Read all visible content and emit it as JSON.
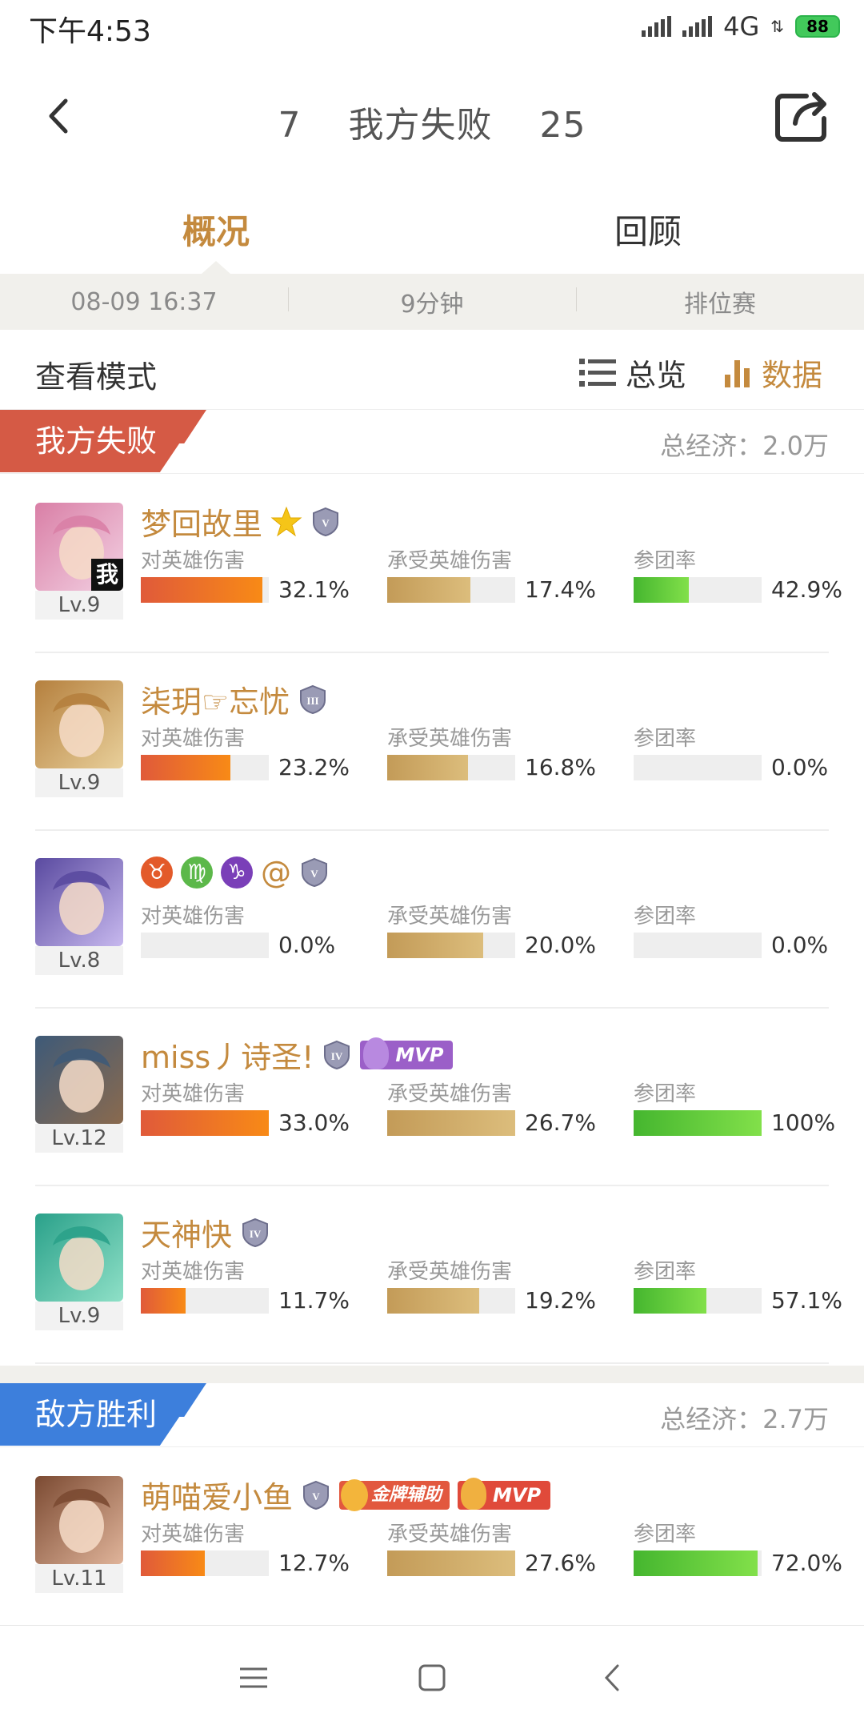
{
  "status": {
    "time": "下午4:53",
    "network": "4G",
    "battery": "88"
  },
  "header": {
    "kills_left": "7",
    "result": "我方失败",
    "kills_right": "25"
  },
  "tabs": [
    {
      "label": "概况"
    },
    {
      "label": "回顾"
    }
  ],
  "info": {
    "datetime": "08-09 16:37",
    "duration": "9分钟",
    "mode": "排位赛"
  },
  "view_mode": {
    "label": "查看模式",
    "overview": "总览",
    "data": "数据"
  },
  "colors": {
    "accent": "#c48a3e",
    "lose": "#d55a45",
    "win": "#3d7fdc"
  },
  "our_team": {
    "label": "我方失败",
    "economy": "总经济：2.0万",
    "players": [
      {
        "name": "梦回故里",
        "level": "Lv.9",
        "rank": "V",
        "is_me": true,
        "me_label": "我",
        "dmg_label": "对英雄伤害",
        "dmg": "32.1%",
        "dmg_frac": 0.95,
        "tak_label": "承受英雄伤害",
        "tak": "17.4%",
        "tak_frac": 0.65,
        "par_label": "参团率",
        "par": "42.9%",
        "par_frac": 0.43
      },
      {
        "name": "柒玥☞忘忧",
        "level": "Lv.9",
        "rank": "III",
        "dmg_label": "对英雄伤害",
        "dmg": "23.2%",
        "dmg_frac": 0.7,
        "tak_label": "承受英雄伤害",
        "tak": "16.8%",
        "tak_frac": 0.63,
        "par_label": "参团率",
        "par": "0.0%",
        "par_frac": 0
      },
      {
        "name": "@",
        "level": "Lv.8",
        "rank": "V",
        "zodiac": [
          "♉",
          "♍",
          "♑"
        ],
        "dmg_label": "对英雄伤害",
        "dmg": "0.0%",
        "dmg_frac": 0,
        "tak_label": "承受英雄伤害",
        "tak": "20.0%",
        "tak_frac": 0.75,
        "par_label": "参团率",
        "par": "0.0%",
        "par_frac": 0
      },
      {
        "name": "miss丿诗圣!",
        "level": "Lv.12",
        "rank": "IV",
        "mvp": "MVP",
        "dmg_label": "对英雄伤害",
        "dmg": "33.0%",
        "dmg_frac": 1.0,
        "tak_label": "承受英雄伤害",
        "tak": "26.7%",
        "tak_frac": 1.0,
        "par_label": "参团率",
        "par": "100%",
        "par_frac": 1.0
      },
      {
        "name": "天神快",
        "level": "Lv.9",
        "rank": "IV",
        "dmg_label": "对英雄伤害",
        "dmg": "11.7%",
        "dmg_frac": 0.35,
        "tak_label": "承受英雄伤害",
        "tak": "19.2%",
        "tak_frac": 0.72,
        "par_label": "参团率",
        "par": "57.1%",
        "par_frac": 0.57
      }
    ]
  },
  "enemy_team": {
    "label": "敌方胜利",
    "economy": "总经济：2.7万",
    "players": [
      {
        "name": "萌喵爱小鱼",
        "level": "Lv.11",
        "rank": "V",
        "badge": "金牌辅助",
        "mvp": "MVP",
        "dmg_label": "对英雄伤害",
        "dmg": "12.7%",
        "dmg_frac": 0.5,
        "tak_label": "承受英雄伤害",
        "tak": "27.6%",
        "tak_frac": 1.0,
        "par_label": "参团率",
        "par": "72.0%",
        "par_frac": 0.97
      }
    ]
  }
}
